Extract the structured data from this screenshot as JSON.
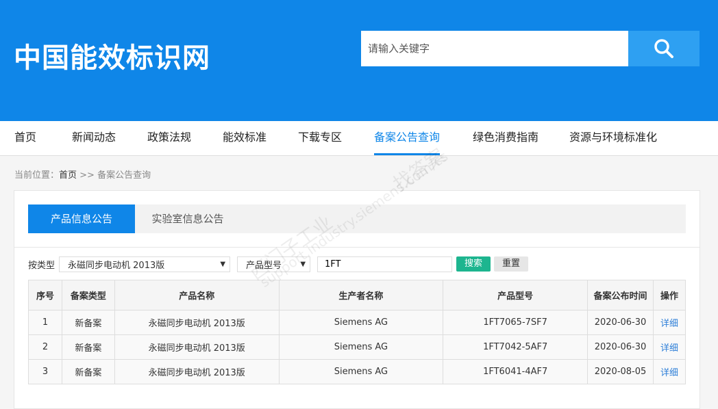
{
  "site": {
    "logo": "中国能效标识网",
    "search_placeholder": "请输入关键字"
  },
  "nav": [
    "首页",
    "新闻动态",
    "政策法规",
    "能效标准",
    "下载专区",
    "备案公告查询",
    "绿色消费指南",
    "资源与环境标准化"
  ],
  "breadcrumb": {
    "label": "当前位置：",
    "home": "首页",
    "sep": " >> ",
    "current": "备案公告查询"
  },
  "tabs": {
    "active": "产品信息公告",
    "other": "实验室信息公告"
  },
  "filters": {
    "type_label": "按类型",
    "type_value": "永磁同步电动机 2013版",
    "field_value": "产品型号",
    "query": "1FT",
    "search": "搜索",
    "reset": "重置"
  },
  "table": {
    "headers": [
      "序号",
      "备案类型",
      "产品名称",
      "生产者名称",
      "产品型号",
      "备案公布时间",
      "操作"
    ],
    "rows": [
      [
        "1",
        "新备案",
        "永磁同步电动机 2013版",
        "Siemens AG",
        "1FT7065-7SF7",
        "2020-06-30",
        "详细"
      ],
      [
        "2",
        "新备案",
        "永磁同步电动机 2013版",
        "Siemens AG",
        "1FT7042-5AF7",
        "2020-06-30",
        "详细"
      ],
      [
        "3",
        "新备案",
        "永磁同步电动机 2013版",
        "Siemens AG",
        "1FT6041-4AF7",
        "2020-08-05",
        "详细"
      ]
    ]
  },
  "watermark": {
    "line1": "西门子工业",
    "line2": "support.industry.siemens.com/cs",
    "line3": "找答案"
  }
}
